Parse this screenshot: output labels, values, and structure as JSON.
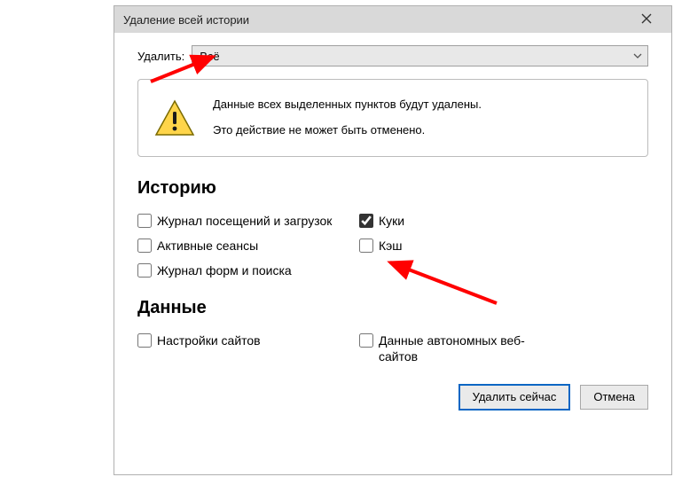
{
  "titlebar": {
    "title": "Удаление всей истории"
  },
  "deleteRow": {
    "label": "Удалить:",
    "selected": "Всё"
  },
  "warning": {
    "line1": "Данные всех выделенных пунктов будут удалены.",
    "line2": "Это действие не может быть отменено."
  },
  "section1": {
    "heading": "Историю",
    "items": {
      "history": {
        "label": "Журнал посещений и загрузок",
        "checked": false
      },
      "cookies": {
        "label": "Куки",
        "checked": true
      },
      "sessions": {
        "label": "Активные сеансы",
        "checked": false
      },
      "cache": {
        "label": "Кэш",
        "checked": false
      },
      "forms": {
        "label": "Журнал форм и поиска",
        "checked": false
      }
    }
  },
  "section2": {
    "heading": "Данные",
    "items": {
      "sitePrefs": {
        "label": "Настройки сайтов",
        "checked": false
      },
      "offline": {
        "label": "Данные автономных веб-сайтов",
        "checked": false
      }
    }
  },
  "buttons": {
    "ok": "Удалить сейчас",
    "cancel": "Отмена"
  }
}
